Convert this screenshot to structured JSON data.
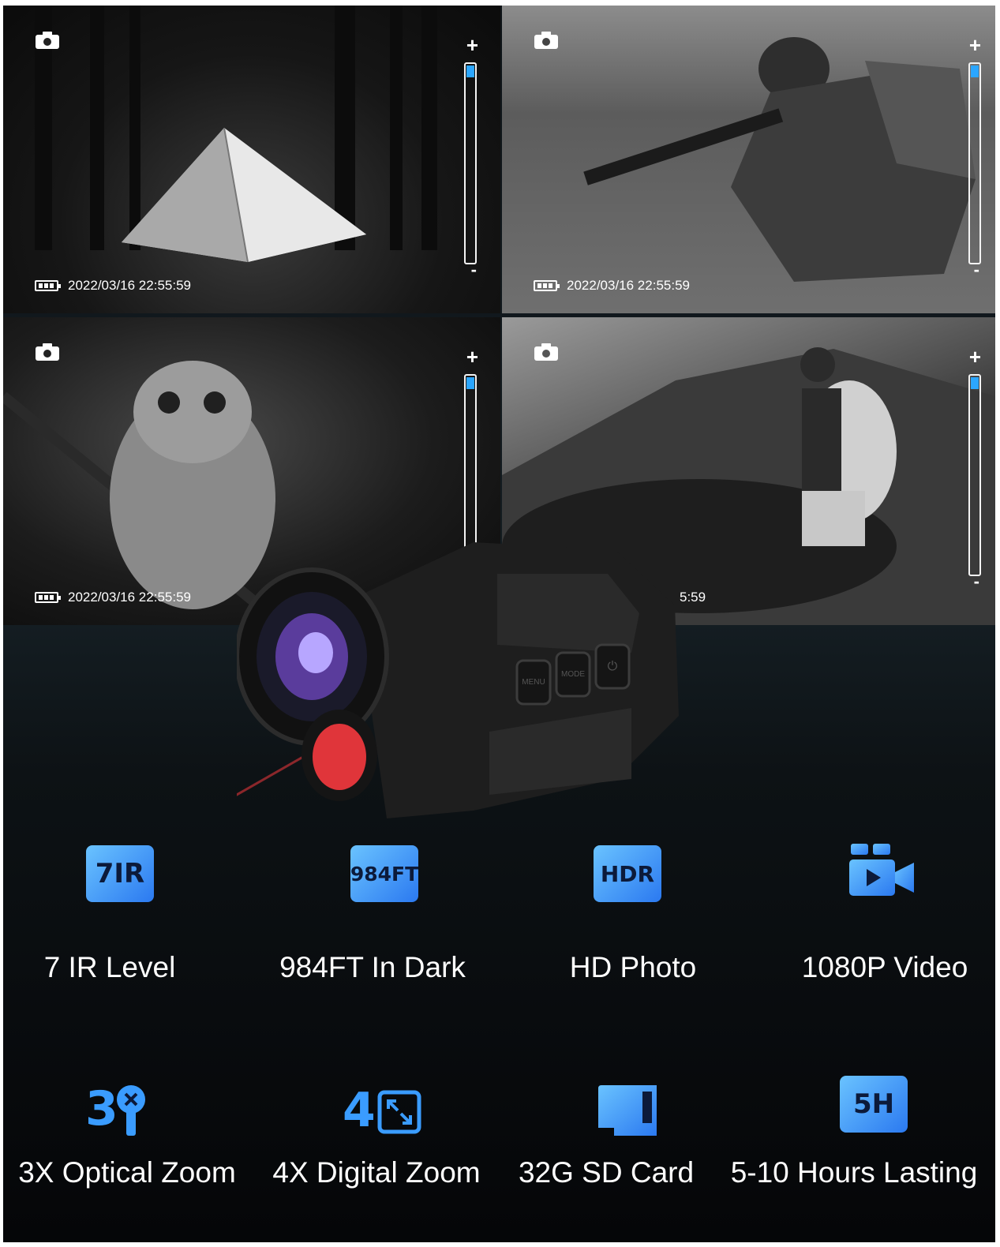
{
  "panels": [
    {
      "name": "tent",
      "timestamp": "2022/03/16  22:55:59",
      "zoom_level": 0.06
    },
    {
      "name": "soldier",
      "timestamp": "2022/03/16  22:55:59",
      "zoom_level": 0.06
    },
    {
      "name": "owl",
      "timestamp": "2022/03/16  22:55:59",
      "zoom_level": 0.06
    },
    {
      "name": "hiker",
      "timestamp": "5:59",
      "zoom_level": 0.06
    }
  ],
  "zoom": {
    "plus": "+",
    "minus": "-"
  },
  "device": {
    "buttons": [
      "MENU",
      "MODE",
      "⏻"
    ]
  },
  "features": [
    {
      "icon": "7IR",
      "icon_name": "ir-level-icon",
      "label": "7 IR Level"
    },
    {
      "icon": "984FT",
      "icon_name": "distance-icon",
      "label": "984FT In Dark"
    },
    {
      "icon": "HDR",
      "icon_name": "hdr-icon",
      "label": "HD Photo"
    },
    {
      "icon": "",
      "icon_name": "video-camera-icon",
      "label": "1080P Video"
    },
    {
      "icon": "3",
      "icon_name": "optical-zoom-icon",
      "label": "3X Optical Zoom"
    },
    {
      "icon": "4",
      "icon_name": "digital-zoom-icon",
      "label": "4X Digital Zoom"
    },
    {
      "icon": "",
      "icon_name": "sd-card-icon",
      "label": "32G SD Card"
    },
    {
      "icon": "5H",
      "icon_name": "battery-hours-icon",
      "label": "5-10 Hours Lasting"
    }
  ],
  "colors": {
    "accent": "#2ba6ff",
    "icon_gradient_start": "#6ac3ff",
    "icon_gradient_end": "#2b79f0",
    "laser": "#e0353a"
  }
}
